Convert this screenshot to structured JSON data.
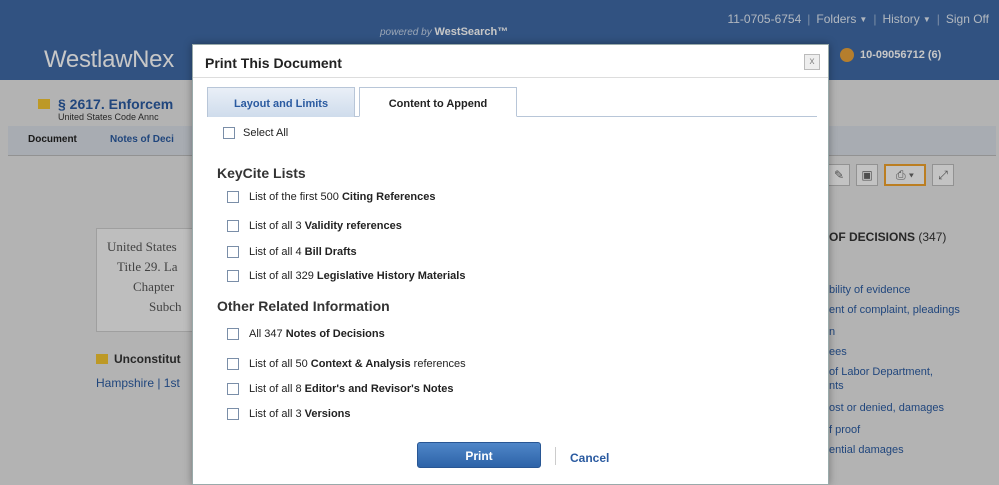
{
  "header": {
    "powered_prefix": "powered by",
    "powered_brand": "WestSearch™",
    "brand_main": "WestlawNex",
    "account": "11-0705-6754",
    "folders": "Folders",
    "history": "History",
    "signoff": "Sign Off",
    "client_id": "10-09056712 (6)"
  },
  "background": {
    "doc_title": "§ 2617. Enforcem",
    "doc_subtitle": "United States Code Annc",
    "tabs": [
      "Document",
      "Notes of Deci"
    ],
    "card_lines": [
      "United States",
      "Title 29. La",
      "Chapter",
      "Subch"
    ],
    "unconstitutional": "Unconstitut",
    "hampshire": "Hampshire | 1st",
    "right_title": "OF DECISIONS",
    "right_count": "(347)",
    "right_links": [
      "bility of evidence",
      "ent of complaint, pleadings",
      "n",
      "ees",
      "of Labor Department,",
      "nts",
      "ost or denied, damages",
      "f proof",
      "ential damages"
    ]
  },
  "dialog": {
    "title": "Print This Document",
    "close": "x",
    "tabs": [
      "Layout and Limits",
      "Content to Append"
    ],
    "select_all": "Select All",
    "keycite_title": "KeyCite Lists",
    "keycite_items": [
      {
        "pre": "List of the first 500 ",
        "bold": "Citing References",
        "post": ""
      },
      {
        "pre": "List of all 3 ",
        "bold": "Validity references",
        "post": ""
      },
      {
        "pre": "List of all 4 ",
        "bold": "Bill Drafts",
        "post": ""
      },
      {
        "pre": "List of all 329 ",
        "bold": "Legislative History Materials",
        "post": ""
      }
    ],
    "other_title": "Other Related Information",
    "other_items": [
      {
        "pre": "All 347 ",
        "bold": "Notes of Decisions",
        "post": ""
      },
      {
        "pre": "List of all 50 ",
        "bold": "Context & Analysis",
        "post": " references"
      },
      {
        "pre": "List of all 8 ",
        "bold": "Editor's and Revisor's Notes",
        "post": ""
      },
      {
        "pre": "List of all 3 ",
        "bold": "Versions",
        "post": ""
      }
    ],
    "print_label": "Print",
    "cancel_label": "Cancel"
  }
}
